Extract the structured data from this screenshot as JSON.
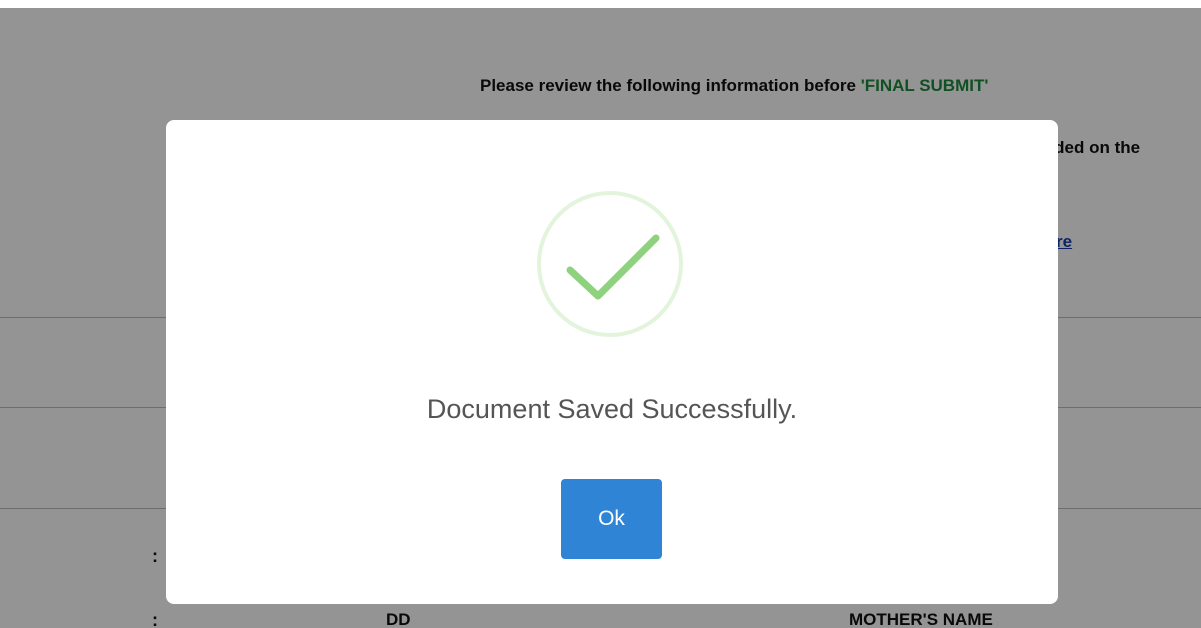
{
  "background": {
    "review_prefix": "Please review the following information before ",
    "review_highlight": "'FINAL SUBMIT'",
    "partial_line": "vided on the",
    "partial_link": "re",
    "colon_1": ":",
    "colon_2": ":",
    "field_value": "DD",
    "field_label": "MOTHER'S NAME"
  },
  "modal": {
    "icon": "checkmark-success-icon",
    "message": "Document Saved Successfully.",
    "ok_label": "Ok"
  },
  "colors": {
    "accent_green": "#1e8a3c",
    "success_green": "#8fd27d",
    "button_blue": "#3084d6",
    "overlay": "rgba(0,0,0,0.42)"
  }
}
